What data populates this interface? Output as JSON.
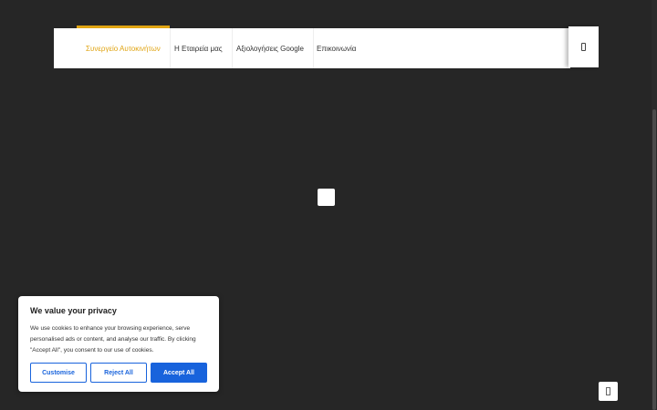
{
  "nav": {
    "items": [
      {
        "label": "Συνεργείο Αυτοκινήτων",
        "active": true
      },
      {
        "label": "Η Εταιρεία μας",
        "active": false
      },
      {
        "label": "Αξιολογήσεις Google",
        "active": false
      },
      {
        "label": "Επικοινωνία",
        "active": false
      }
    ],
    "menu_icon": "menu-icon"
  },
  "cookie": {
    "title": "We value your privacy",
    "body": "We use cookies to enhance your browsing experience, serve personalised ads or content, and analyse our traffic. By clicking \"Accept All\", you consent to our use of cookies.",
    "customise_label": "Customise",
    "reject_label": "Reject All",
    "accept_label": "Accept All"
  },
  "colors": {
    "accent": "#e0a412",
    "cookie_button": "#1863dc",
    "background": "#262626"
  }
}
